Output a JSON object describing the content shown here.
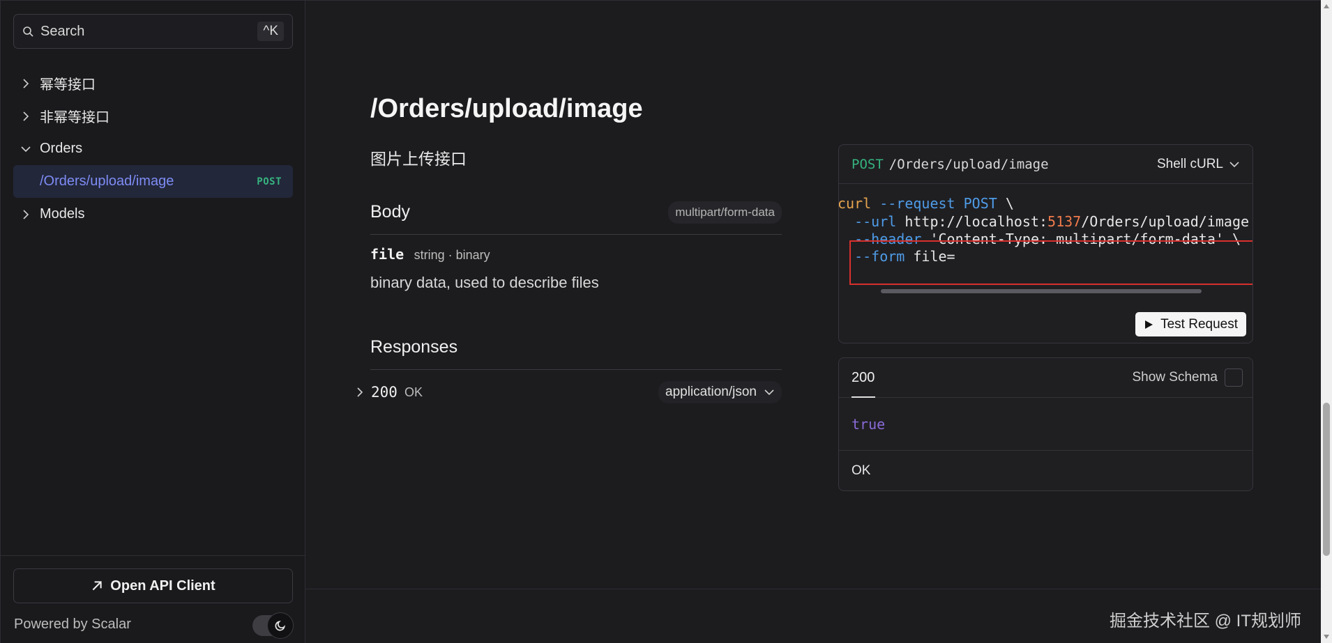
{
  "search": {
    "label": "Search",
    "shortcut": "^K"
  },
  "sidebar": {
    "items": [
      {
        "label": "幂等接口"
      },
      {
        "label": "非幂等接口"
      },
      {
        "label": "Orders"
      },
      {
        "label": "/Orders/upload/image",
        "method": "POST"
      },
      {
        "label": "Models"
      }
    ],
    "open_client_label": "Open API Client",
    "powered_by": "Powered by Scalar"
  },
  "endpoint": {
    "title": "/Orders/upload/image",
    "description": "图片上传接口",
    "body": {
      "heading": "Body",
      "content_type": "multipart/form-data",
      "param_name": "file",
      "param_type": "string · binary",
      "param_desc": "binary data, used to describe files"
    },
    "responses": {
      "heading": "Responses",
      "code": "200",
      "status": "OK",
      "content_type": "application/json"
    }
  },
  "code_card": {
    "method": "POST",
    "path": "/Orders/upload/image",
    "language": "Shell cURL",
    "lines": {
      "l1_cmd": "curl",
      "l1_flag": " --request",
      "l1_val": " POST",
      "l1_end": " \\",
      "l2_flag": "  --url",
      "l2_val_a": " http://localhost:",
      "l2_port": "5137",
      "l2_val_b": "/Orders/upload/image \\",
      "l3_flag": "  --header",
      "l3_val": " 'Content-Type: multipart/form-data' \\",
      "l4_flag": "  --form",
      "l4_val": " file="
    },
    "test_label": "Test Request"
  },
  "response_card": {
    "tab": "200",
    "schema_label": "Show Schema",
    "value": "true",
    "status": "OK"
  },
  "watermark": "掘金技术社区 @ IT规划师",
  "colors": {
    "accent": "#7e8cf5",
    "method_post": "#36b37e",
    "highlight": "#d9302c"
  }
}
